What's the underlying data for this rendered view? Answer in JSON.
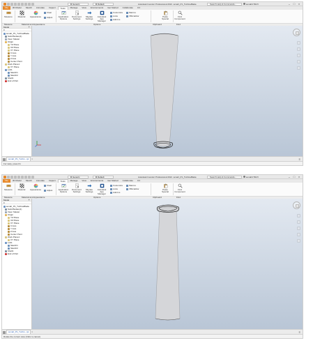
{
  "colors": {
    "file_tab": "#e8892a",
    "viewport_top": "#e3e9f1",
    "viewport_bottom": "#b9c6d6",
    "model_fill": "#d4d5d8",
    "model_edge": "#3a3a3a"
  },
  "title_bar": {
    "style_combo": "Generic",
    "appearance_combo": "Default",
    "app_title": "Autodesk Inventor Professional 2021",
    "file_name": "iemah_P1_TurbineBlade",
    "search_placeholder": "Search Help & Commands...",
    "user": "iemahCTRAY",
    "minimize": "–",
    "restore": "□",
    "close": "×"
  },
  "tabs": [
    "File",
    "3D Model",
    "Sketch",
    "Annotate",
    "Inspect",
    "Tools",
    "Manage",
    "View",
    "Environments",
    "Get Started",
    "Collaborate",
    "CC"
  ],
  "active_tab": "Tools",
  "ribbon": {
    "measure": "Measure",
    "materials": "Material",
    "appearance": "Appearance",
    "clear": "Clear",
    "adjust": "Adjust",
    "application_options": "Application Options",
    "document_settings": "Document Settings",
    "migrate_settings": "Migrate Settings",
    "app_manager": "Autodesk App Manager",
    "customize": "Customize",
    "links": "Links",
    "macros": "Macros",
    "vba_editor": "VBA Editor",
    "add_ins": "Add-Ins",
    "paste_special": "Paste Special",
    "find_component": "Find Component",
    "panel_measure": "Measure",
    "panel_material": "Material and Appearance",
    "panel_options": "Options",
    "panel_clipboard": "Clipboard",
    "panel_find": "Find"
  },
  "browser": {
    "title": "Model",
    "plus": "+",
    "search_label": "≡",
    "items": [
      {
        "label": "iemah_P1_TurbineBlade",
        "icon": "part-icon"
      },
      {
        "label": "Solid Bodies(1)",
        "icon": "solid-body-icon"
      },
      {
        "label": "View: Master",
        "icon": "view-icon"
      },
      {
        "label": "Origin",
        "icon": "folder-icon"
      },
      {
        "label": "YZ Plane",
        "icon": "plane-icon"
      },
      {
        "label": "XZ Plane",
        "icon": "plane-icon"
      },
      {
        "label": "XY Plane",
        "icon": "plane-icon"
      },
      {
        "label": "X Axis",
        "icon": "axis-icon"
      },
      {
        "label": "Y Axis",
        "icon": "axis-icon"
      },
      {
        "label": "Z Axis",
        "icon": "axis-icon"
      },
      {
        "label": "Center Point",
        "icon": "point-icon"
      },
      {
        "label": "Work Plane1",
        "icon": "plane-icon"
      },
      {
        "label": "XY Plane",
        "icon": "plane-icon"
      },
      {
        "label": "Loft1",
        "icon": "loft-icon"
      },
      {
        "label": "Sketch1",
        "icon": "sketch-icon"
      },
      {
        "label": "Sketch2",
        "icon": "sketch-icon"
      },
      {
        "label": "Shell1",
        "icon": "shell-icon"
      },
      {
        "label": "End of Part",
        "icon": "end-of-part-icon"
      }
    ]
  },
  "document_tab": {
    "name": "iemah_P1_Turbin...ipt",
    "close": "×",
    "menu": "≡"
  },
  "status": {
    "top": "For Help, press F1",
    "bottom": "Rotate the current view (Click to cancel)"
  }
}
